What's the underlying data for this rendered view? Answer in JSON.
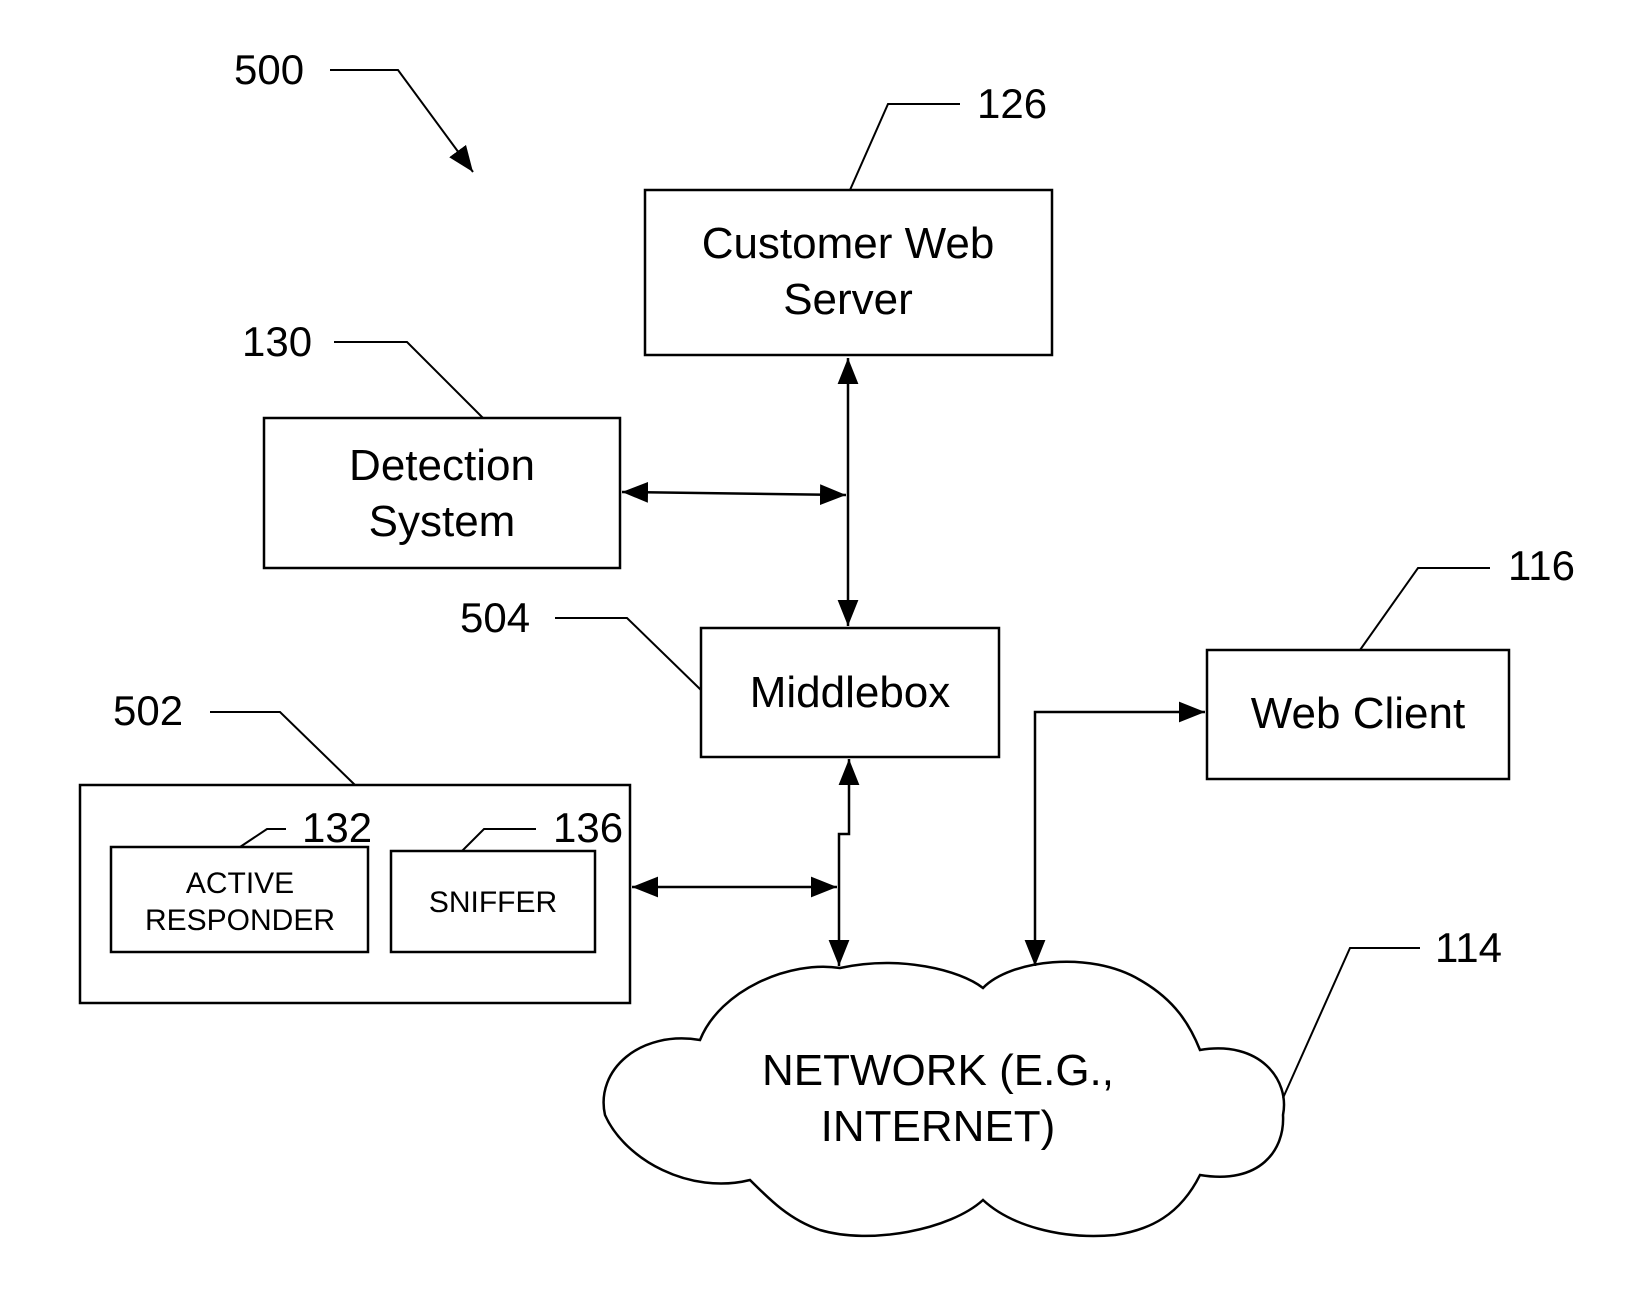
{
  "figure": {
    "ref": "500"
  },
  "nodes": {
    "customer_web_server": {
      "ref": "126",
      "lines": [
        "Customer Web",
        "Server"
      ]
    },
    "detection_system": {
      "ref": "130",
      "lines": [
        "Detection",
        "System"
      ]
    },
    "middlebox": {
      "ref": "504",
      "lines": [
        "Middlebox"
      ]
    },
    "web_client": {
      "ref": "116",
      "lines": [
        "Web Client"
      ]
    },
    "group_502": {
      "ref": "502"
    },
    "active_responder": {
      "ref": "132",
      "lines": [
        "ACTIVE",
        "RESPONDER"
      ]
    },
    "sniffer": {
      "ref": "136",
      "lines": [
        "SNIFFER"
      ]
    },
    "network": {
      "ref": "114",
      "lines": [
        "NETWORK (E.G.,",
        "INTERNET)"
      ]
    }
  }
}
